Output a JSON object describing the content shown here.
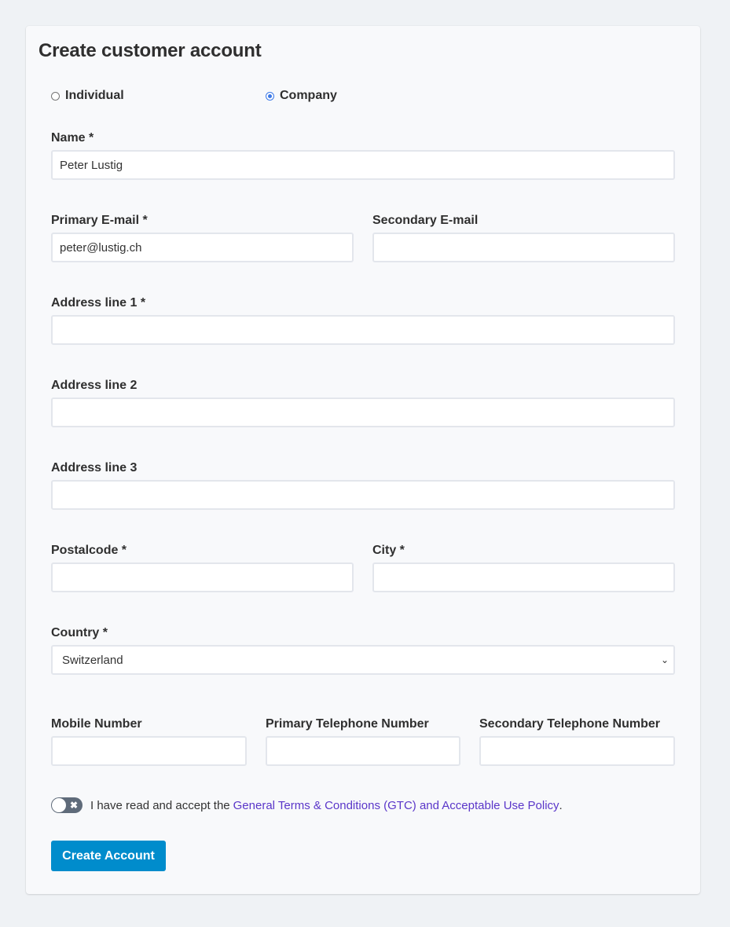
{
  "form": {
    "title": "Create customer account",
    "account_type": {
      "options": [
        {
          "label": "Individual",
          "checked": false
        },
        {
          "label": "Company",
          "checked": true
        }
      ]
    },
    "fields": {
      "name": {
        "label": "Name *",
        "value": "Peter Lustig"
      },
      "primary_email": {
        "label": "Primary E-mail *",
        "value": "peter@lustig.ch"
      },
      "secondary_email": {
        "label": "Secondary E-mail",
        "value": ""
      },
      "address1": {
        "label": "Address line 1 *",
        "value": ""
      },
      "address2": {
        "label": "Address line 2",
        "value": ""
      },
      "address3": {
        "label": "Address line 3",
        "value": ""
      },
      "postalcode": {
        "label": "Postalcode *",
        "value": ""
      },
      "city": {
        "label": "City *",
        "value": ""
      },
      "country": {
        "label": "Country *",
        "value": "Switzerland"
      },
      "mobile": {
        "label": "Mobile Number",
        "value": ""
      },
      "primary_phone": {
        "label": "Primary Telephone Number",
        "value": ""
      },
      "secondary_phone": {
        "label": "Secondary Telephone Number",
        "value": ""
      }
    },
    "terms": {
      "toggle_on": false,
      "text": "I have read and accept the",
      "link": "General Terms & Conditions (GTC) and Acceptable Use Policy",
      "suffix": "."
    },
    "submit_label": "Create Account"
  },
  "colors": {
    "accent": "#008ccc",
    "link": "#5a36c9",
    "radio_checked": "#3b78e7",
    "page_bg": "#eff2f5",
    "card_bg": "#f8f9fb"
  }
}
